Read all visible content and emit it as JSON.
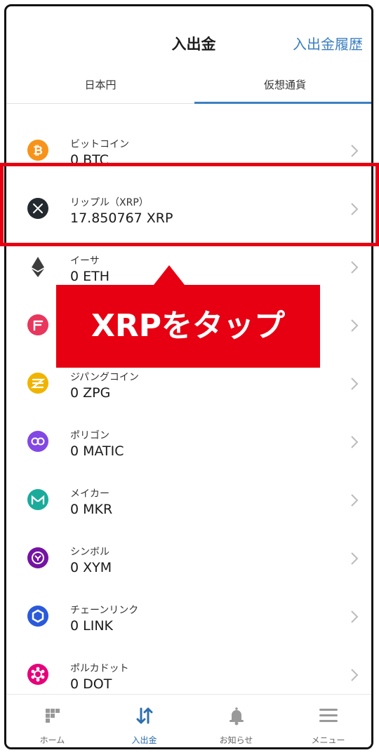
{
  "header": {
    "title": "入出金",
    "history_link": "入出金履歴"
  },
  "tabs": [
    {
      "label": "日本円",
      "active": false
    },
    {
      "label": "仮想通貨",
      "active": true
    }
  ],
  "coins": [
    {
      "name": "ビットコイン",
      "amount": "0 BTC",
      "icon": "bitcoin-icon",
      "color": "#f7931a"
    },
    {
      "name": "リップル（XRP）",
      "amount": "17.850767 XRP",
      "icon": "xrp-icon",
      "color": "#23292f"
    },
    {
      "name": "イーサ",
      "amount": "0 ETH",
      "icon": "ethereum-icon",
      "color": "#3c3c3d"
    },
    {
      "name": "",
      "amount": "",
      "icon": "fcr-icon",
      "color": "#e8365d"
    },
    {
      "name": "ジパングコイン",
      "amount": "0 ZPG",
      "icon": "zpg-icon",
      "color": "#f0b400"
    },
    {
      "name": "ポリゴン",
      "amount": "0 MATIC",
      "icon": "polygon-icon",
      "color": "#8247e5"
    },
    {
      "name": "メイカー",
      "amount": "0 MKR",
      "icon": "maker-icon",
      "color": "#1aab9b"
    },
    {
      "name": "シンボル",
      "amount": "0 XYM",
      "icon": "symbol-icon",
      "color": "#7413a4"
    },
    {
      "name": "チェーンリンク",
      "amount": "0 LINK",
      "icon": "chainlink-icon",
      "color": "#2a5ada"
    },
    {
      "name": "ポルカドット",
      "amount": "0 DOT",
      "icon": "polkadot-icon",
      "color": "#e6007a"
    }
  ],
  "annotation": {
    "callout_text": "XRPをタップ",
    "color": "#e60012"
  },
  "bottom_nav": [
    {
      "label": "ホーム",
      "icon": "home-icon",
      "active": false
    },
    {
      "label": "入出金",
      "icon": "transfer-icon",
      "active": true
    },
    {
      "label": "お知らせ",
      "icon": "bell-icon",
      "active": false
    },
    {
      "label": "メニュー",
      "icon": "menu-icon",
      "active": false
    }
  ],
  "colors": {
    "accent": "#3c7fc1",
    "nav_active": "#2f6fae"
  }
}
